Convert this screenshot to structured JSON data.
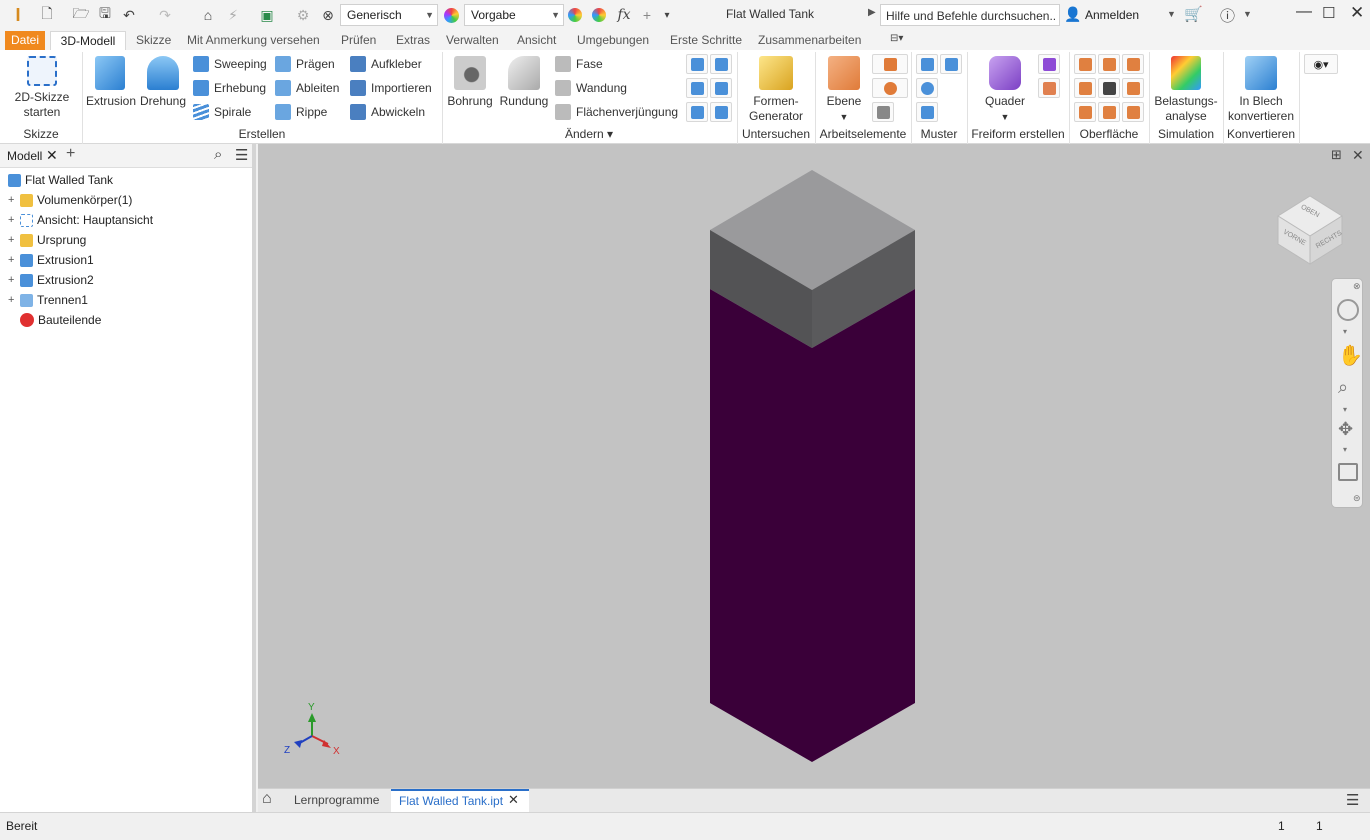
{
  "app": {
    "title": "Flat Walled Tank",
    "search_placeholder": "Hilfe und Befehle durchsuchen..",
    "signin": "Anmelden"
  },
  "quick_access": {
    "material": "Generisch",
    "appearance": "Vorgabe"
  },
  "tabs": [
    "Datei",
    "3D-Modell",
    "Skizze",
    "Mit Anmerkung versehen",
    "Prüfen",
    "Extras",
    "Verwalten",
    "Ansicht",
    "Umgebungen",
    "Erste Schritte",
    "Zusammenarbeiten"
  ],
  "active_tab": "3D-Modell",
  "ribbon": {
    "sketch": {
      "btn1": "2D-Skizze",
      "btn2": "starten",
      "panel": "Skizze"
    },
    "create": {
      "extrusion": "Extrusion",
      "revolve": "Drehung",
      "sweep": "Sweeping",
      "loft": "Erhebung",
      "coil": "Spirale",
      "emboss": "Prägen",
      "derive": "Ableiten",
      "rib": "Rippe",
      "decal": "Aufkleber",
      "import": "Importieren",
      "unwrap": "Abwickeln",
      "panel": "Erstellen"
    },
    "modify": {
      "hole": "Bohrung",
      "fillet": "Rundung",
      "chamfer": "Fase",
      "shell": "Wandung",
      "draft": "Flächenverjüngung",
      "panel": "Ändern ▾"
    },
    "explore": {
      "btn1": "Formen-",
      "btn2": "Generator",
      "panel": "Untersuchen"
    },
    "workfeatures": {
      "plane": "Ebene",
      "panel": "Arbeitselemente"
    },
    "pattern": {
      "panel": "Muster"
    },
    "freeform": {
      "box": "Quader",
      "panel": "Freiform erstellen"
    },
    "surface": {
      "panel": "Oberfläche"
    },
    "simulation": {
      "btn1": "Belastungs-",
      "btn2": "analyse",
      "panel": "Simulation"
    },
    "convert": {
      "btn1": "In Blech",
      "btn2": "konvertieren",
      "panel": "Konvertieren"
    }
  },
  "browser": {
    "tab": "Modell",
    "items": [
      {
        "label": "Flat Walled Tank"
      },
      {
        "label": "Volumenkörper(1)"
      },
      {
        "label": "Ansicht: Hauptansicht"
      },
      {
        "label": "Ursprung"
      },
      {
        "label": "Extrusion1"
      },
      {
        "label": "Extrusion2"
      },
      {
        "label": "Trennen1"
      },
      {
        "label": "Bauteilende"
      }
    ]
  },
  "viewcube": {
    "top": "OBEN",
    "front": "VORNE",
    "right": "RECHTS"
  },
  "triad": {
    "x": "X",
    "y": "Y",
    "z": "Z"
  },
  "doc_tabs": {
    "home": "Lernprogramme",
    "active": "Flat Walled Tank.ipt"
  },
  "status": {
    "text": "Bereit",
    "n1": "1",
    "n2": "1"
  },
  "colors": {
    "accent": "#f0891e",
    "body": "#3a0039",
    "top": "#999999",
    "viewport": "#c3c3c3"
  }
}
